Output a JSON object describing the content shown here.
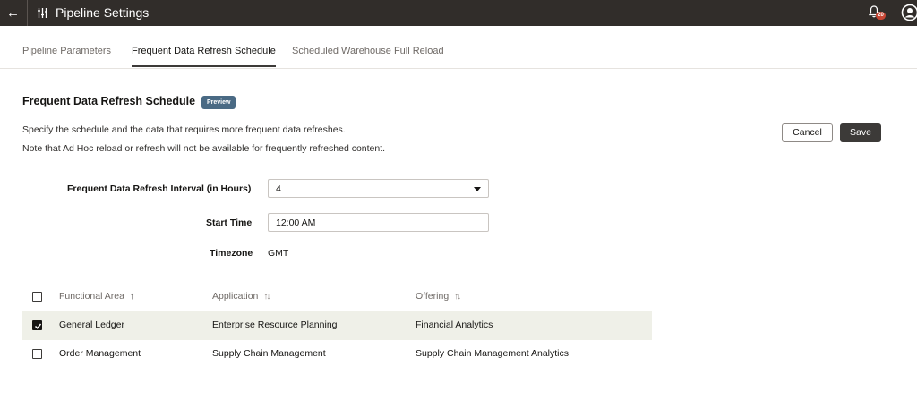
{
  "header": {
    "title": "Pipeline Settings",
    "notification_count": "20"
  },
  "tabs": [
    {
      "label": "Pipeline Parameters",
      "active": false
    },
    {
      "label": "Frequent Data Refresh Schedule",
      "active": true
    },
    {
      "label": "Scheduled Warehouse Full Reload",
      "active": false
    }
  ],
  "section": {
    "title": "Frequent Data Refresh Schedule",
    "badge": "Preview",
    "description_1": "Specify the schedule and the data that requires more frequent data refreshes.",
    "description_2": "Note that Ad Hoc reload or refresh will not be available for frequently refreshed content."
  },
  "actions": {
    "cancel_label": "Cancel",
    "save_label": "Save"
  },
  "form": {
    "interval_label": "Frequent Data Refresh Interval (in Hours)",
    "interval_value": "4",
    "start_time_label": "Start Time",
    "start_time_value": "12:00 AM",
    "timezone_label": "Timezone",
    "timezone_value": "GMT"
  },
  "table": {
    "columns": {
      "functional_area": "Functional Area",
      "application": "Application",
      "offering": "Offering"
    },
    "sort_icons": {
      "ascending": "↑",
      "unsorted": "↑↓"
    },
    "rows": [
      {
        "functional_area": "General Ledger",
        "application": "Enterprise Resource Planning",
        "offering": "Financial Analytics",
        "checked": true
      },
      {
        "functional_area": "Order Management",
        "application": "Supply Chain Management",
        "offering": "Supply Chain Management Analytics",
        "checked": false
      }
    ]
  },
  "colors": {
    "topbar": "#312d2a",
    "badge_preview": "#4a6a84",
    "selected_row": "#eff0e8",
    "notification_badge": "#c74634"
  }
}
